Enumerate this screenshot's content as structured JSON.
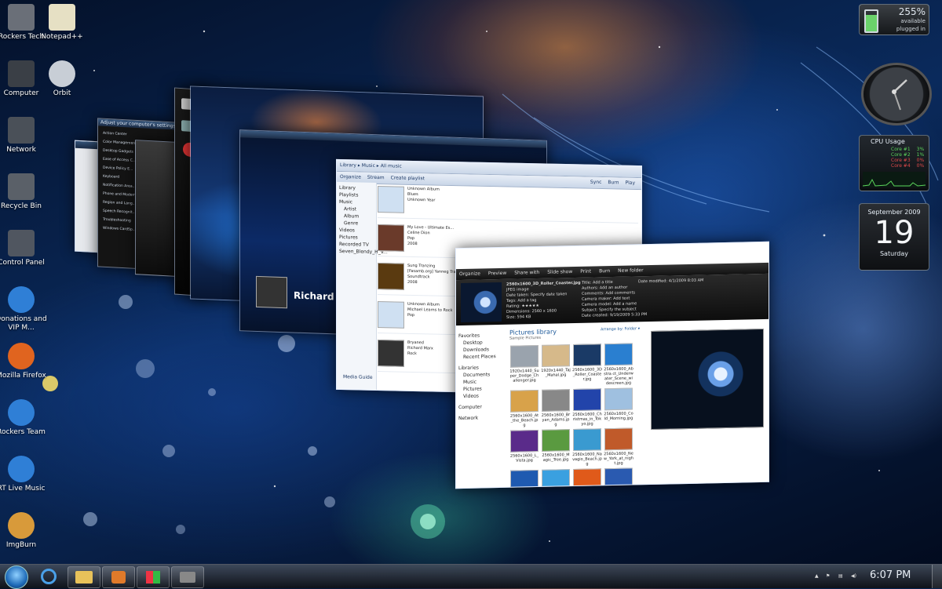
{
  "desktop_icons": [
    {
      "label": "Rockers Tech",
      "icon": "folder-gear-icon"
    },
    {
      "label": "Notepad++",
      "icon": "notepad-icon"
    },
    {
      "label": "Computer",
      "icon": "computer-icon"
    },
    {
      "label": "Orbit",
      "icon": "orbit-download-icon"
    },
    {
      "label": "Network",
      "icon": "network-icon"
    },
    {
      "label": "Recycle Bin",
      "icon": "recycle-bin-icon"
    },
    {
      "label": "Control Panel",
      "icon": "control-panel-icon"
    },
    {
      "label": "Donations and VIP M...",
      "icon": "internet-explorer-icon"
    },
    {
      "label": "Mozilla Firefox",
      "icon": "firefox-icon"
    },
    {
      "label": "Rockers Team",
      "icon": "internet-explorer-icon"
    },
    {
      "label": "RT Live Music",
      "icon": "internet-explorer-icon"
    },
    {
      "label": "ImgBurn",
      "icon": "imgburn-icon"
    }
  ],
  "battery_gadget": {
    "percent": "255%",
    "status": "available",
    "state": "plugged in"
  },
  "cpu_gadget": {
    "title": "CPU Usage",
    "cores": [
      {
        "label": "Core #1",
        "value": "3%"
      },
      {
        "label": "Core #2",
        "value": "1%"
      },
      {
        "label": "Core #3",
        "value": "0%"
      },
      {
        "label": "Core #4",
        "value": "0%"
      }
    ]
  },
  "calendar_gadget": {
    "month": "September 2009",
    "day": "19",
    "weekday": "Saturday"
  },
  "media_player": {
    "toolbar": [
      "Organize",
      "Stream",
      "Create playlist"
    ],
    "tabs": [
      "Play",
      "Burn",
      "Sync"
    ],
    "breadcrumb": "Library ▸ Music ▸ All music",
    "nav": [
      "Library",
      "Playlists",
      "Music",
      "Artist",
      "Album",
      "Genre",
      "Videos",
      "Pictures",
      "Recorded TV",
      "Seven_Blendy_H_V..."
    ],
    "albums": [
      {
        "title": "Unknown Album",
        "artist": "Blues",
        "genre": "Unknown Year"
      },
      {
        "title": "My Love - Ultimate Es...",
        "artist": "Celine Dion",
        "genre": "Pop",
        "year": "2008"
      },
      {
        "title": "Sung Tranzing",
        "artist": "[Fasamb.org] Yanneg Tran...",
        "genre": "Soundtrack",
        "year": "2008"
      },
      {
        "title": "Unknown Album",
        "artist": "Michael Learns to Rock",
        "genre": "Pop"
      },
      {
        "title": "Bryaned",
        "artist": "Richard Marx",
        "genre": "Rock"
      }
    ],
    "footer": "Media Guide",
    "now_playing": "Richard Marx"
  },
  "photo_explorer": {
    "toolbar": [
      "Organize",
      "Preview",
      "Share with",
      "Slide show",
      "Print",
      "Burn",
      "New folder"
    ],
    "details": {
      "filename": "2560x1600_3D_Roller_Coaster.jpg",
      "type": "JPEG image",
      "date_taken": "Date taken: Specify date taken",
      "tags": "Tags: Add a tag",
      "rating": "Rating: ★★★★★",
      "dimensions": "Dimensions: 2560 x 1600",
      "size": "Size: 594 KB",
      "title": "Title: Add a title",
      "authors": "Authors: Add an author",
      "comments": "Comments: Add comments",
      "camera_maker": "Camera maker: Add text",
      "camera_model": "Camera model: Add a name",
      "subject": "Subject: Specify the subject",
      "date_created": "Date created: 9/19/2009 5:33 PM",
      "date_modified": "Date modified: 4/1/2009 8:03 AM"
    },
    "library_title": "Pictures library",
    "library_sub": "Sample Pictures",
    "arrange": "Arrange by: Folder ▾",
    "nav": [
      "Favorites",
      "Desktop",
      "Downloads",
      "Recent Places",
      "Libraries",
      "Documents",
      "Music",
      "Pictures",
      "Videos",
      "Computer",
      "Network"
    ],
    "thumbs": [
      {
        "name": "1920x1440_Super_Dodge_Challenger.jpg",
        "color": "#9aa3ad"
      },
      {
        "name": "1920x1440_Taj_Mahal.jpg",
        "color": "#d6b98a"
      },
      {
        "name": "2560x1600_3D_Roller_Coaster.jpg",
        "color": "#1a3a66"
      },
      {
        "name": "2560x1600_Abstra ct_Underwater_Scene_widescreen.jpg",
        "color": "#2a7fd0"
      },
      {
        "name": "2560x1600_At_the_Beach.jpg",
        "color": "#d8a24a"
      },
      {
        "name": "2560x1600_Bryan_Adams.jpg",
        "color": "#888"
      },
      {
        "name": "2560x1600_Christmas_in_Tokyo.jpg",
        "color": "#2244aa"
      },
      {
        "name": "2560x1600_Cold_Morning.jpg",
        "color": "#9fc0e0"
      },
      {
        "name": "2560x1600_L_Vista.jpg",
        "color": "#5a2b8a"
      },
      {
        "name": "2560x1600_Magic_Tree.jpg",
        "color": "#5a9a40"
      },
      {
        "name": "2560x1600_Navagio_Beach.jpg",
        "color": "#3a9ad0"
      },
      {
        "name": "2560x1600_New_York_at_night.jpg",
        "color": "#c05a2a"
      },
      {
        "name": "",
        "color": "#1f5ab0"
      },
      {
        "name": "",
        "color": "#3aa0e0"
      },
      {
        "name": "",
        "color": "#e05a1a"
      },
      {
        "name": "",
        "color": "#2a5ab0"
      }
    ]
  },
  "control_panel_window": {
    "title": "Adjust your computer's settings",
    "items": [
      "Action Center",
      "Color Management",
      "Desktop Gadgets",
      "Ease of Access C...",
      "Device Policy E...",
      "Keyboard",
      "Notification Area...",
      "Phone and Modem",
      "Region and Lang...",
      "Speech Recognit...",
      "Troubleshooting",
      "Windows CardSp..."
    ]
  },
  "taskbar": {
    "buttons": [
      "start-orb",
      "internet-explorer",
      "windows-explorer",
      "media-player",
      "windows-flag",
      "control-panel"
    ],
    "time": "6:07 PM"
  }
}
